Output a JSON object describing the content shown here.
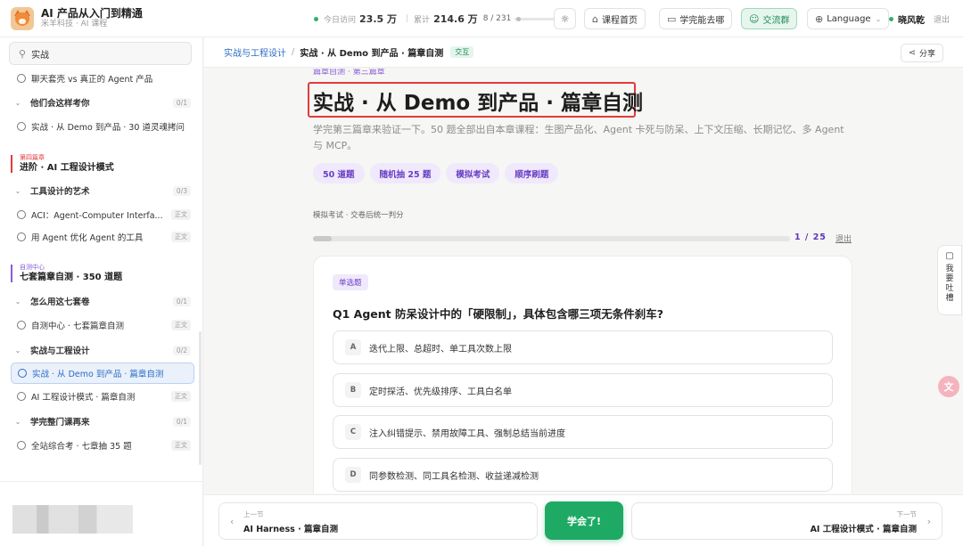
{
  "header": {
    "brand_title": "AI 产品从入门到精通",
    "brand_subtitle": "米羊科技 · AI 课程",
    "stats": {
      "today_label": "今日访问",
      "today_value": "23.5 万",
      "total_label": "累计",
      "total_value": "214.6 万",
      "progress_text": "8 / 231",
      "progress_fraction": 0.035
    },
    "buttons": {
      "course_home": "课程首页",
      "after_learning": "学完能去哪",
      "community": "交流群",
      "language": "Language"
    },
    "user": {
      "name": "晓风乾",
      "logout": "退出"
    }
  },
  "sidebar": {
    "search_value": "实战",
    "items": {
      "chat_vs_agent": "聊天套壳 vs 真正的 Agent 产品",
      "group_how_tested": {
        "label": "他们会这样考你",
        "count": "0/1"
      },
      "item_30_questions": "实战 · 从 Demo 到产品 · 30 道灵魂拷问",
      "chapter4": {
        "tag": "第四篇章",
        "title": "进阶 · AI 工程设计模式"
      },
      "group_tool_design": {
        "label": "工具设计的艺术",
        "count": "0/3"
      },
      "item_aci": {
        "label": "ACI：Agent-Computer Interfa...",
        "tag": "正文"
      },
      "item_optimize_tools": {
        "label": "用 Agent 优化 Agent 的工具",
        "tag": "正文"
      },
      "test_center": {
        "tag": "自测中心",
        "title": "七套篇章自测 · 350 道题"
      },
      "group_how_use": {
        "label": "怎么用这七套卷",
        "count": "0/1"
      },
      "item_test_center": {
        "label": "自测中心 · 七套篇章自测",
        "tag": "正文"
      },
      "group_practice": {
        "label": "实战与工程设计",
        "count": "0/2"
      },
      "item_demo_product": "实战 · 从 Demo 到产品 · 篇章自测",
      "item_ai_patterns": {
        "label": "AI 工程设计模式 · 篇章自测",
        "tag": "正文"
      },
      "group_final": {
        "label": "学完整门课再来",
        "count": "0/1"
      },
      "item_final_exam": {
        "label": "全站综合考 · 七章抽 35 题",
        "tag": "正文"
      }
    }
  },
  "breadcrumb": {
    "parent": "实战与工程设计",
    "separator": "/",
    "current": "实战 · 从 Demo 到产品 · 篇章自测",
    "badge": "交互",
    "share": "分享"
  },
  "main": {
    "kicker": "篇章自测 · 第三篇章",
    "title": "实战 · 从 Demo 到产品 · 篇章自测",
    "description": "学完第三篇章来验证一下。50 题全部出自本章课程：生图产品化、Agent 卡死与防呆、上下文压缩、长期记忆、多 Agent 与 MCP。",
    "chips": [
      "50 道题",
      "随机抽 25 题",
      "模拟考试",
      "顺序刷题"
    ],
    "mode_text": "模拟考试 · 交卷后统一判分",
    "progress_text": "1 / 25",
    "progress_fraction": 0.04,
    "exit": "退出"
  },
  "question": {
    "type": "单选题",
    "text": "Q1 Agent 防呆设计中的「硬限制」，具体包含哪三项无条件刹车?",
    "options": [
      {
        "letter": "A",
        "text": "迭代上限、总超时、单工具次数上限"
      },
      {
        "letter": "B",
        "text": "定时探活、优先级排序、工具白名单"
      },
      {
        "letter": "C",
        "text": "注入纠错提示、禁用故障工具、强制总结当前进度"
      },
      {
        "letter": "D",
        "text": "同参数检测、同工具名检测、收益递减检测"
      }
    ]
  },
  "feedback": {
    "label": "我要吐槽"
  },
  "bottom_nav": {
    "prev_small": "上一节",
    "prev_title": "AI Harness · 篇章自测",
    "learned": "学会了!",
    "next_small": "下一节",
    "next_title": "AI 工程设计模式 · 篇章自测"
  },
  "colors": {
    "accent_purple": "#6a3fc4",
    "accent_green": "#1eaa64",
    "link_blue": "#2c6bc4",
    "highlight_red": "#e23b3b"
  },
  "icons": [
    "search-icon",
    "sun-icon",
    "home-icon",
    "briefcase-icon",
    "people-icon",
    "globe-icon",
    "share-icon",
    "comment-icon",
    "translate-icon",
    "chevron-left-icon",
    "chevron-right-icon"
  ]
}
